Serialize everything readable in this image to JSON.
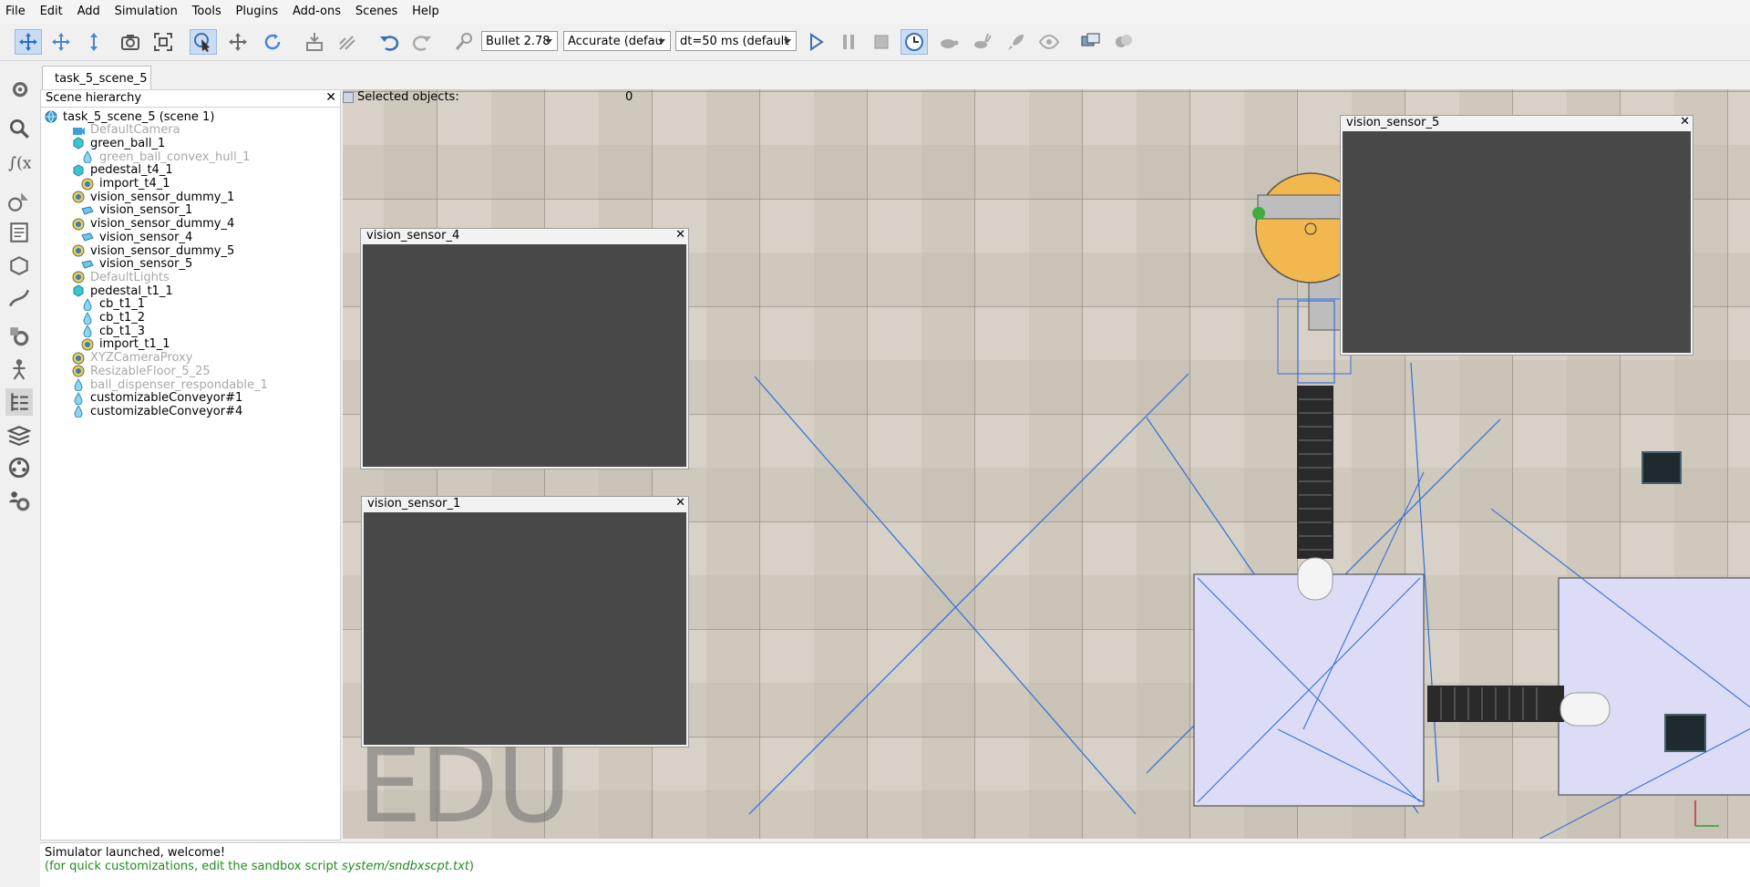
{
  "menu": [
    "File",
    "Edit",
    "Add",
    "Simulation",
    "Tools",
    "Plugins",
    "Add-ons",
    "Scenes",
    "Help"
  ],
  "toolbar": {
    "engine": "Bullet 2.78",
    "accuracy": "Accurate (defau",
    "timestep": "dt=50 ms (default"
  },
  "scene_tab": "task_5_scene_5",
  "hierarchy": {
    "title": "Scene hierarchy",
    "items": [
      {
        "label": "task_5_scene_5 (scene 1)",
        "depth": 0,
        "grey": false,
        "icon": "globe-icon"
      },
      {
        "label": "DefaultCamera",
        "depth": 1,
        "grey": true,
        "icon": "camera-icon"
      },
      {
        "label": "green_ball_1",
        "depth": 1,
        "grey": false,
        "icon": "cube-icon"
      },
      {
        "label": "green_ball_convex_hull_1",
        "depth": 2,
        "grey": true,
        "icon": "drop-icon"
      },
      {
        "label": "pedestal_t4_1",
        "depth": 1,
        "grey": false,
        "icon": "cube-icon"
      },
      {
        "label": "import_t4_1",
        "depth": 2,
        "grey": false,
        "icon": "dummy-icon"
      },
      {
        "label": "vision_sensor_dummy_1",
        "depth": 1,
        "grey": false,
        "icon": "dummy-icon"
      },
      {
        "label": "vision_sensor_1",
        "depth": 2,
        "grey": false,
        "icon": "sensor-icon"
      },
      {
        "label": "vision_sensor_dummy_4",
        "depth": 1,
        "grey": false,
        "icon": "dummy-icon"
      },
      {
        "label": "vision_sensor_4",
        "depth": 2,
        "grey": false,
        "icon": "sensor-icon"
      },
      {
        "label": "vision_sensor_dummy_5",
        "depth": 1,
        "grey": false,
        "icon": "dummy-icon"
      },
      {
        "label": "vision_sensor_5",
        "depth": 2,
        "grey": false,
        "icon": "sensor-icon"
      },
      {
        "label": "DefaultLights",
        "depth": 1,
        "grey": true,
        "icon": "dummy-icon"
      },
      {
        "label": "pedestal_t1_1",
        "depth": 1,
        "grey": false,
        "icon": "cube-icon"
      },
      {
        "label": "cb_t1_1",
        "depth": 2,
        "grey": false,
        "icon": "drop-icon"
      },
      {
        "label": "cb_t1_2",
        "depth": 2,
        "grey": false,
        "icon": "drop-icon"
      },
      {
        "label": "cb_t1_3",
        "depth": 2,
        "grey": false,
        "icon": "drop-icon"
      },
      {
        "label": "import_t1_1",
        "depth": 2,
        "grey": false,
        "icon": "dummy-icon"
      },
      {
        "label": "XYZCameraProxy",
        "depth": 1,
        "grey": true,
        "icon": "dummy-icon"
      },
      {
        "label": "ResizableFloor_5_25",
        "depth": 1,
        "grey": true,
        "icon": "dummy-icon"
      },
      {
        "label": "ball_dispenser_respondable_1",
        "depth": 1,
        "grey": true,
        "icon": "drop-icon"
      },
      {
        "label": "customizableConveyor#1",
        "depth": 1,
        "grey": false,
        "icon": "drop-icon"
      },
      {
        "label": "customizableConveyor#4",
        "depth": 1,
        "grey": false,
        "icon": "drop-icon"
      }
    ]
  },
  "viewport": {
    "selected_label": "Selected objects:",
    "selected_count": "0",
    "watermark": "EDU",
    "sensors": {
      "s4": "vision_sensor_4",
      "s1": "vision_sensor_1",
      "s5": "vision_sensor_5"
    }
  },
  "console": {
    "line1": "Simulator launched, welcome!",
    "line2_prefix": "(for quick customizations, edit the sandbox script ",
    "line2_path": "system/sndbxscpt.txt",
    "line2_suffix": ")"
  }
}
